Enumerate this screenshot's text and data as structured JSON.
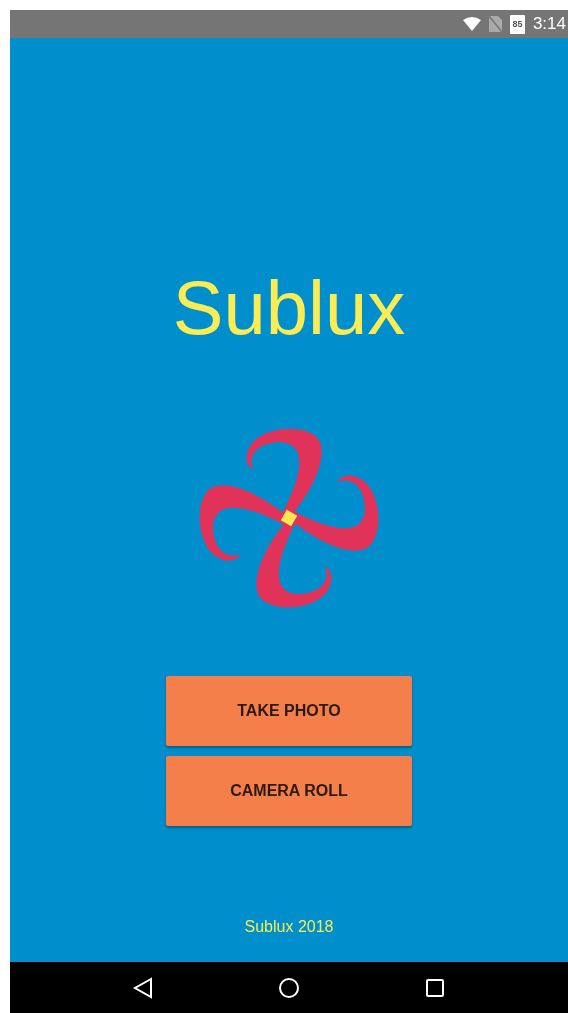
{
  "status_bar": {
    "battery": "85",
    "time": "3:14"
  },
  "title": "Sublux",
  "buttons": [
    {
      "label": "TAKE PHOTO"
    },
    {
      "label": "CAMERA ROLL"
    }
  ],
  "footer": "Sublux 2018"
}
